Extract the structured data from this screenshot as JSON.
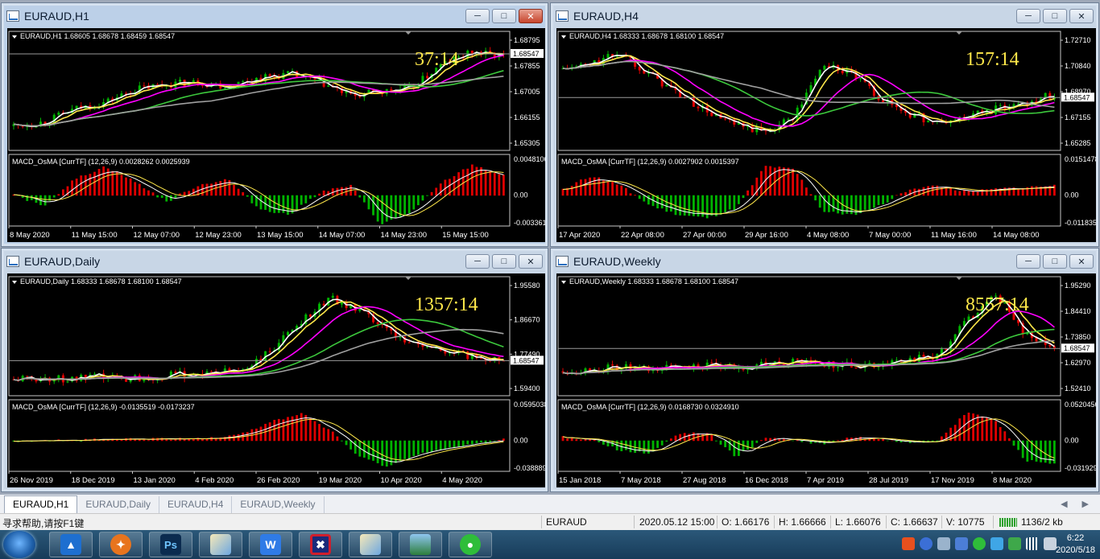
{
  "windows": [
    {
      "title": "EURAUD,H1",
      "active": true,
      "ohlc": "EURAUD,H1  1.68605 1.68678 1.68459 1.68547",
      "price_labels": [
        "1.68795",
        "1.67855",
        "1.67005",
        "1.66155",
        "1.65305"
      ],
      "current_price": "1.68547",
      "timer": "37:14",
      "macd_label": "MACD_OsMA [CurrTF] (12,26,9) 0.0028262 0.0025939",
      "macd_labels": [
        "0.0048106",
        "0.00",
        "-0.003361"
      ],
      "time_labels": [
        "8 May 2020",
        "11 May 15:00",
        "12 May 07:00",
        "12 May 23:00",
        "13 May 15:00",
        "14 May 07:00",
        "14 May 23:00",
        "15 May 15:00"
      ]
    },
    {
      "title": "EURAUD,H4",
      "active": false,
      "ohlc": "EURAUD,H4  1.68333 1.68678 1.68100 1.68547",
      "price_labels": [
        "1.72710",
        "1.70840",
        "1.68970",
        "1.67155",
        "1.65285"
      ],
      "current_price": "1.68547",
      "timer": "157:14",
      "macd_label": "MACD_OsMA [CurrTF] (12,26,9) 0.0027902 0.0015397",
      "macd_labels": [
        "0.0151478",
        "0.00",
        "-0.011835"
      ],
      "time_labels": [
        "17 Apr 2020",
        "22 Apr 08:00",
        "27 Apr 00:00",
        "29 Apr 16:00",
        "4 May 08:00",
        "7 May 00:00",
        "11 May 16:00",
        "14 May 08:00"
      ]
    },
    {
      "title": "EURAUD,Daily",
      "active": false,
      "ohlc": "EURAUD,Daily  1.68333 1.68678 1.68100 1.68547",
      "price_labels": [
        "1.95580",
        "1.86670",
        "1.77490",
        "1.59400"
      ],
      "current_price": "1.68547",
      "timer": "1357:14",
      "macd_label": "MACD_OsMA [CurrTF] (12,26,9) -0.0135519 -0.0173237",
      "macd_labels": [
        "0.0595038",
        "0.00",
        "-0.038889"
      ],
      "time_labels": [
        "26 Nov 2019",
        "18 Dec 2019",
        "13 Jan 2020",
        "4 Feb 2020",
        "26 Feb 2020",
        "19 Mar 2020",
        "10 Apr 2020",
        "4 May 2020"
      ]
    },
    {
      "title": "EURAUD,Weekly",
      "active": false,
      "ohlc": "EURAUD,Weekly  1.68333 1.68678 1.68100 1.68547",
      "price_labels": [
        "1.95290",
        "1.84410",
        "1.73850",
        "1.62970",
        "1.52410"
      ],
      "current_price": "1.68547",
      "timer": "8557:14",
      "macd_label": "MACD_OsMA [CurrTF] (12,26,9) 0.0168730 0.0324910",
      "macd_labels": [
        "0.0520456",
        "0.00",
        "-0.031929"
      ],
      "time_labels": [
        "15 Jan 2018",
        "7 May 2018",
        "27 Aug 2018",
        "16 Dec 2018",
        "7 Apr 2019",
        "28 Jul 2019",
        "17 Nov 2019",
        "8 Mar 2020"
      ]
    }
  ],
  "tabs": [
    "EURAUD,H1",
    "EURAUD,Daily",
    "EURAUD,H4",
    "EURAUD,Weekly"
  ],
  "status": {
    "help": "寻求帮助,请按F1键",
    "symbol": "EURAUD",
    "datetime": "2020.05.12 15:00",
    "open": "O: 1.66176",
    "high": "H: 1.66666",
    "low": "L: 1.66076",
    "close": "C: 1.66637",
    "volume": "V: 10775",
    "traffic": "1136/2 kb"
  },
  "taskbar": {
    "apps": [
      "mt-app",
      "fox-app",
      "photoshop-app",
      "paint-app",
      "wps-app",
      "flag-app",
      "paint-app-2",
      "photo-app",
      "wechat-app"
    ],
    "time": "6:22",
    "date": "2020/5/18"
  },
  "colors": {
    "bull": "#00b400",
    "bear": "#e00000",
    "ma_white": "#ffffff",
    "ma_yellow": "#ffe84a",
    "ma_magenta": "#ff00ff",
    "ma_green": "#3cc83c",
    "ma_gray": "#a0a0a0",
    "timer": "#ffe84a"
  }
}
